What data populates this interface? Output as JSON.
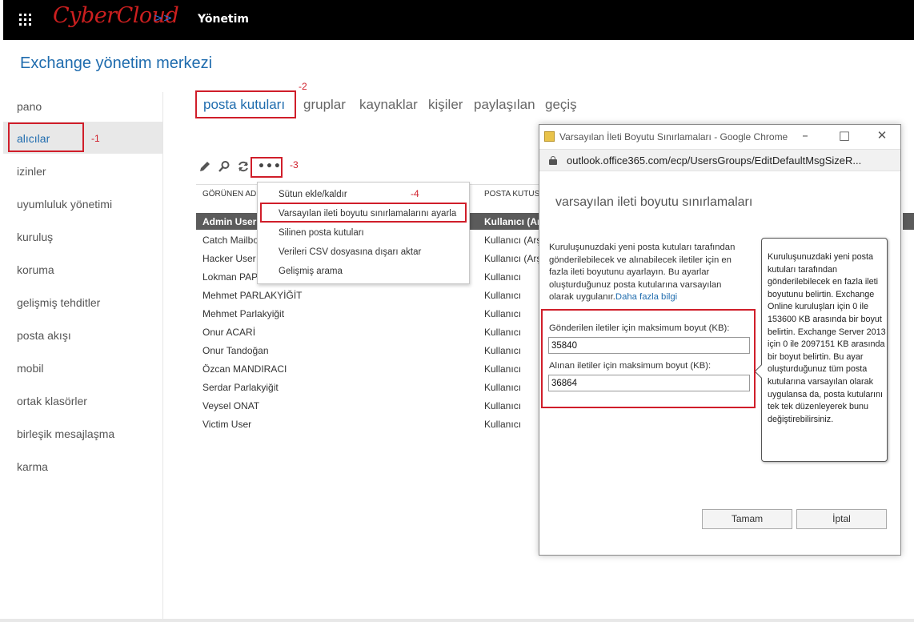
{
  "header": {
    "logo_text": "CyberCloud",
    "logo_arrow": ">>",
    "app_title": "Yönetim"
  },
  "page_title": "Exchange yönetim merkezi",
  "nav": {
    "items": [
      {
        "label": "pano"
      },
      {
        "label": "alıcılar",
        "selected": true
      },
      {
        "label": "izinler"
      },
      {
        "label": "uyumluluk yönetimi"
      },
      {
        "label": "kuruluş"
      },
      {
        "label": "koruma"
      },
      {
        "label": "gelişmiş tehditler"
      },
      {
        "label": "posta akışı"
      },
      {
        "label": "mobil"
      },
      {
        "label": "ortak klasörler"
      },
      {
        "label": "birleşik mesajlaşma"
      },
      {
        "label": "karma"
      }
    ]
  },
  "tabs": [
    {
      "label": "posta kutuları",
      "active": true
    },
    {
      "label": "gruplar"
    },
    {
      "label": "kaynaklar"
    },
    {
      "label": "kişiler"
    },
    {
      "label": "paylaşılan"
    },
    {
      "label": "geçiş"
    }
  ],
  "annotations": {
    "step1": "-1",
    "step2": "-2",
    "step3": "-3",
    "step4": "-4"
  },
  "toolbar": {
    "edit_icon": "pencil-icon",
    "search_icon": "search-icon",
    "refresh_icon": "refresh-icon",
    "more_label": "•••"
  },
  "table": {
    "columns": [
      "GÖRÜNEN AD",
      "POSTA KUTUSU"
    ],
    "rows": [
      {
        "name": "Admin User",
        "type": "Kullanıcı (Arşiv)",
        "selected": true
      },
      {
        "name": "Catch Mailbox",
        "type": "Kullanıcı (Arşiv)"
      },
      {
        "name": "Hacker User",
        "type": "Kullanıcı (Arşiv)"
      },
      {
        "name": "Lokman PAPAKYIGIT",
        "type": "Kullanıcı"
      },
      {
        "name": "Mehmet PARLAKYİĞİT",
        "type": "Kullanıcı"
      },
      {
        "name": "Mehmet Parlakyiğit",
        "type": "Kullanıcı"
      },
      {
        "name": "Onur ACARİ",
        "type": "Kullanıcı"
      },
      {
        "name": "Onur Tandoğan",
        "type": "Kullanıcı"
      },
      {
        "name": "Özcan MANDIRACI",
        "type": "Kullanıcı"
      },
      {
        "name": "Serdar Parlakyiğit",
        "type": "Kullanıcı"
      },
      {
        "name": "Veysel ONAT",
        "type": "Kullanıcı"
      },
      {
        "name": "Victim User",
        "type": "Kullanıcı"
      }
    ]
  },
  "menu": {
    "items": [
      {
        "label": "Sütun ekle/kaldır"
      },
      {
        "label": "Varsayılan ileti boyutu sınırlamalarını ayarla",
        "highlighted": true
      },
      {
        "label": "Silinen posta kutuları"
      },
      {
        "label": "Verileri CSV dosyasına dışarı aktar"
      },
      {
        "label": "Gelişmiş arama"
      }
    ]
  },
  "dialog": {
    "window_title": "Varsayılan İleti Boyutu Sınırlamaları - Google Chrome",
    "url": "outlook.office365.com/ecp/UsersGroups/EditDefaultMsgSizeR...",
    "heading": "varsayılan ileti boyutu sınırlamaları",
    "description": "Kuruluşunuzdaki yeni posta kutuları tarafından gönderilebilecek ve alınabilecek iletiler için en fazla ileti boyutunu ayarlayın. Bu ayarlar oluşturduğunuz posta kutularına varsayılan olarak uygulanır.",
    "more_info_link": "Daha fazla bilgi",
    "sent_label": "Gönderilen iletiler için maksimum boyut (KB):",
    "sent_value": "35840",
    "received_label": "Alınan iletiler için maksimum boyut (KB):",
    "received_value": "36864",
    "tooltip": "Kuruluşunuzdaki yeni posta kutuları tarafından gönderilebilecek en fazla ileti boyutunu belirtin. Exchange Online kuruluşları için 0 ile 153600 KB arasında bir boyut belirtin. Exchange Server 2013 için 0 ile 2097151 KB arasında bir boyut belirtin. Bu ayar oluşturduğunuz tüm posta kutularına varsayılan olarak uygulansa da, posta kutularını tek tek düzenleyerek bunu değiştirebilirsiniz.",
    "ok_label": "Tamam",
    "cancel_label": "İptal",
    "minimize_icon": "minimize-icon",
    "maximize_icon": "maximize-icon",
    "close_icon": "close-icon"
  },
  "colors": {
    "accent": "#1f6cae",
    "annotation_red": "#d01e2a",
    "selected_row": "#5b5b5b",
    "topbar": "#000000"
  }
}
